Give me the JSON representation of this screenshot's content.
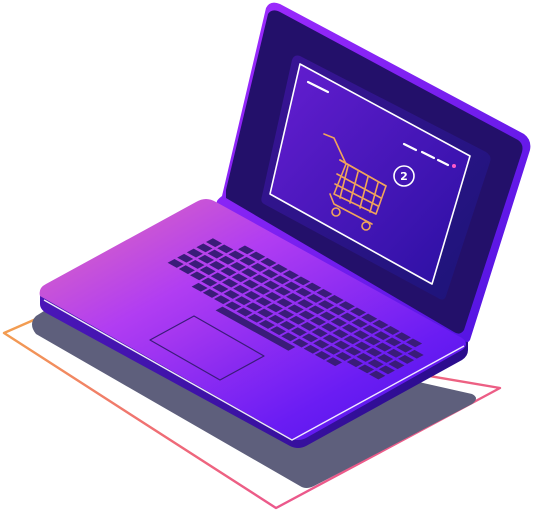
{
  "illustration": {
    "subject": "laptop-shopping-cart",
    "icons": [
      "shopping-cart-icon",
      "notification-badge-icon"
    ]
  },
  "cart": {
    "badge_count": "2"
  },
  "colors": {
    "background": "#ffffff",
    "lid_edge": "#5a1fd6",
    "screen_bezel": "#231470",
    "screen_inner": "#2c0e9e",
    "cart_outline": "#f0a45a",
    "window_outline": "#ffffff",
    "keyboard_keys": "#3a1c79",
    "deck_light": "#c046f0",
    "deck_dark": "#5c1cf0",
    "shadow": "#5e5f7c",
    "frame_outline": "#f07a5a"
  }
}
